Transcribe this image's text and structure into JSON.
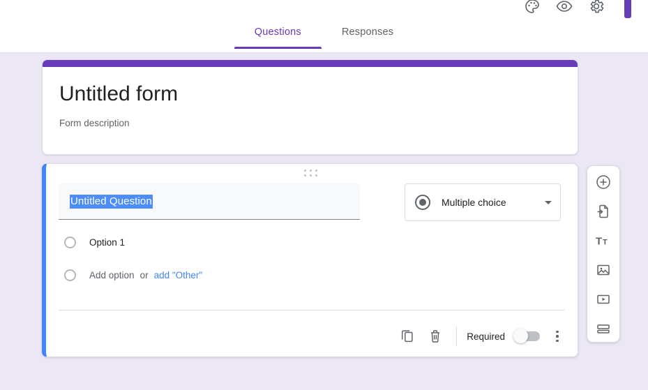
{
  "topbar": {
    "icons": [
      {
        "name": "palette-icon",
        "title": "Customize theme"
      },
      {
        "name": "eye-icon",
        "title": "Preview"
      },
      {
        "name": "gear-icon",
        "title": "Settings"
      }
    ],
    "send_button_label": ""
  },
  "tabs": [
    {
      "id": "questions",
      "label": "Questions",
      "active": true
    },
    {
      "id": "responses",
      "label": "Responses",
      "active": false
    }
  ],
  "form_header": {
    "title": "Untitled form",
    "description": "Form description",
    "stripe_color": "#673ab7"
  },
  "question": {
    "title_value": "Untitled Question",
    "title_selected": true,
    "type_label": "Multiple choice",
    "type_icon": "radio-filled-icon",
    "options": [
      {
        "label": "Option 1"
      }
    ],
    "add_option_label": "Add option",
    "or_label": "or",
    "add_other_label": "add \"Other\"",
    "required_label": "Required",
    "required_on": false,
    "accent_color": "#4285f4",
    "actions": [
      {
        "name": "duplicate-question-button",
        "title": "Duplicate"
      },
      {
        "name": "delete-question-button",
        "title": "Delete"
      }
    ]
  },
  "side_toolbar": [
    {
      "name": "add-question-button",
      "title": "Add question"
    },
    {
      "name": "import-questions-button",
      "title": "Import questions"
    },
    {
      "name": "add-title-description-button",
      "title": "Add title and description"
    },
    {
      "name": "add-image-button",
      "title": "Add image"
    },
    {
      "name": "add-video-button",
      "title": "Add video"
    },
    {
      "name": "add-section-button",
      "title": "Add section"
    }
  ],
  "colors": {
    "canvas_background": "#ece7f4",
    "theme_purple": "#673ab7",
    "active_blue": "#4285f4",
    "selection_blue": "#4c8dfa"
  }
}
